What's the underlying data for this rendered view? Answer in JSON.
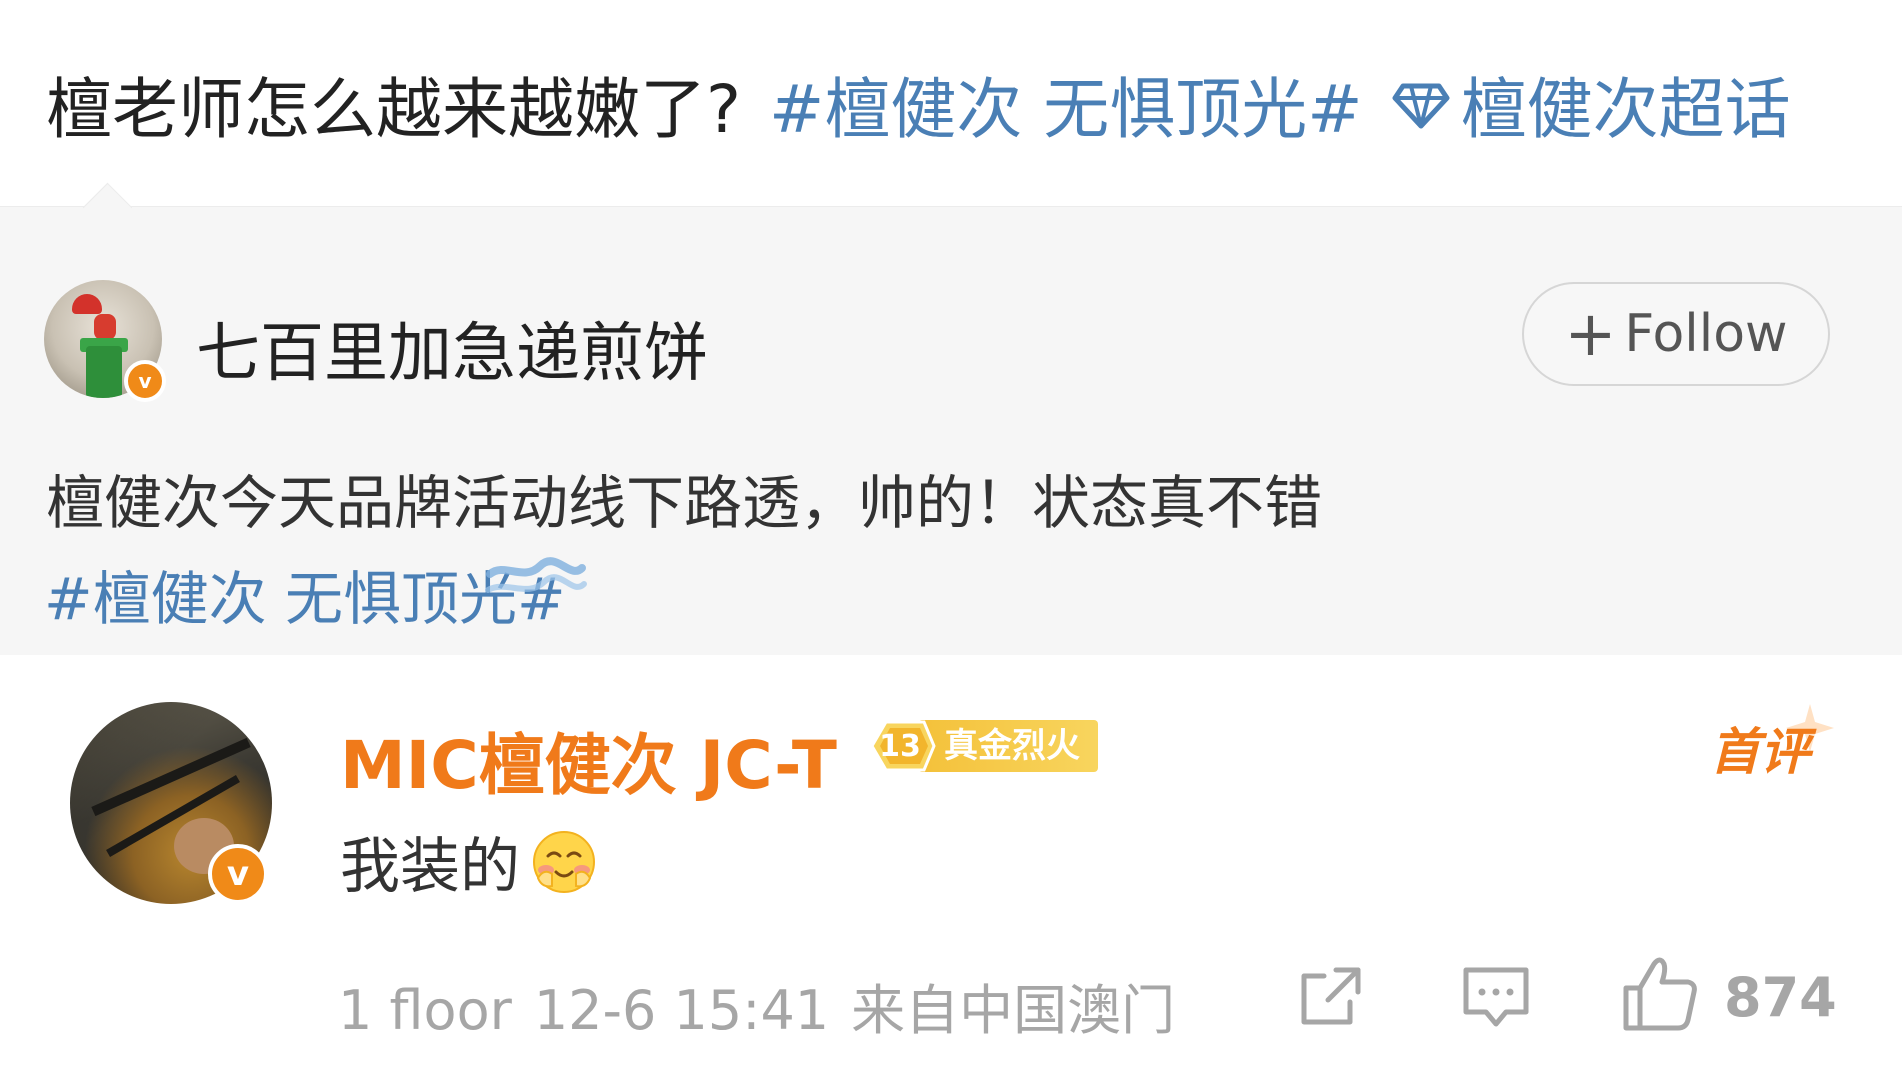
{
  "post": {
    "question": "檀老师怎么越来越嫩了?",
    "topic": "#檀健次 无惧顶光#",
    "super_topic": "檀健次超话"
  },
  "repost": {
    "author_name": "七百里加急递煎饼",
    "follow_label": "Follow",
    "text": "檀健次今天品牌活动线下路透，帅的！状态真不错",
    "tag": "#檀健次 无惧顶光#",
    "verified_mark": "v"
  },
  "reply": {
    "author_name": "MIC檀健次 JC-T",
    "fan_level": "13",
    "fan_label": "真金烈火",
    "first_comment_label": "首评",
    "text": "我装的",
    "verified_mark": "v",
    "floor": "1 floor",
    "time": "12-6 15:41",
    "location": "来自中国澳门",
    "like_count": "874"
  },
  "colors": {
    "link": "#4a7fb5",
    "accent_orange": "#f07a1a",
    "muted": "#a6a6a6",
    "card_bg": "#f6f6f6"
  },
  "icons": [
    "diamond-icon",
    "plus-icon",
    "verified-icon",
    "level-badge-icon",
    "emoji-blush-icon",
    "share-icon",
    "comment-icon",
    "like-icon"
  ]
}
